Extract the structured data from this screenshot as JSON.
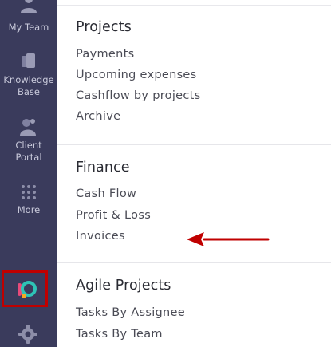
{
  "sidebar": {
    "items": [
      {
        "label_line1": "My Team",
        "label_line2": "",
        "icon": "team-icon"
      },
      {
        "label_line1": "Knowledge",
        "label_line2": "Base",
        "icon": "knowledge-base-icon"
      },
      {
        "label_line1": "Client",
        "label_line2": "Portal",
        "icon": "client-portal-icon"
      },
      {
        "label_line1": "More",
        "label_line2": "",
        "icon": "grid-dots-icon"
      }
    ],
    "logo_icon": "app-logo-icon",
    "settings_icon": "gear-icon"
  },
  "sections": [
    {
      "title": "Projects",
      "links": [
        "Payments",
        "Upcoming expenses",
        "Cashflow by projects",
        "Archive"
      ]
    },
    {
      "title": "Finance",
      "links": [
        "Cash Flow",
        "Profit & Loss",
        "Invoices"
      ]
    },
    {
      "title": "Agile Projects",
      "links": [
        "Tasks By Assignee",
        "Tasks By Team"
      ]
    }
  ],
  "annotation": {
    "highlight_color": "#c00000",
    "arrow_target": "Invoices"
  },
  "colors": {
    "sidebar_bg": "#3a3b5c",
    "sidebar_text": "#c9cadb",
    "accent": "#c00000"
  }
}
